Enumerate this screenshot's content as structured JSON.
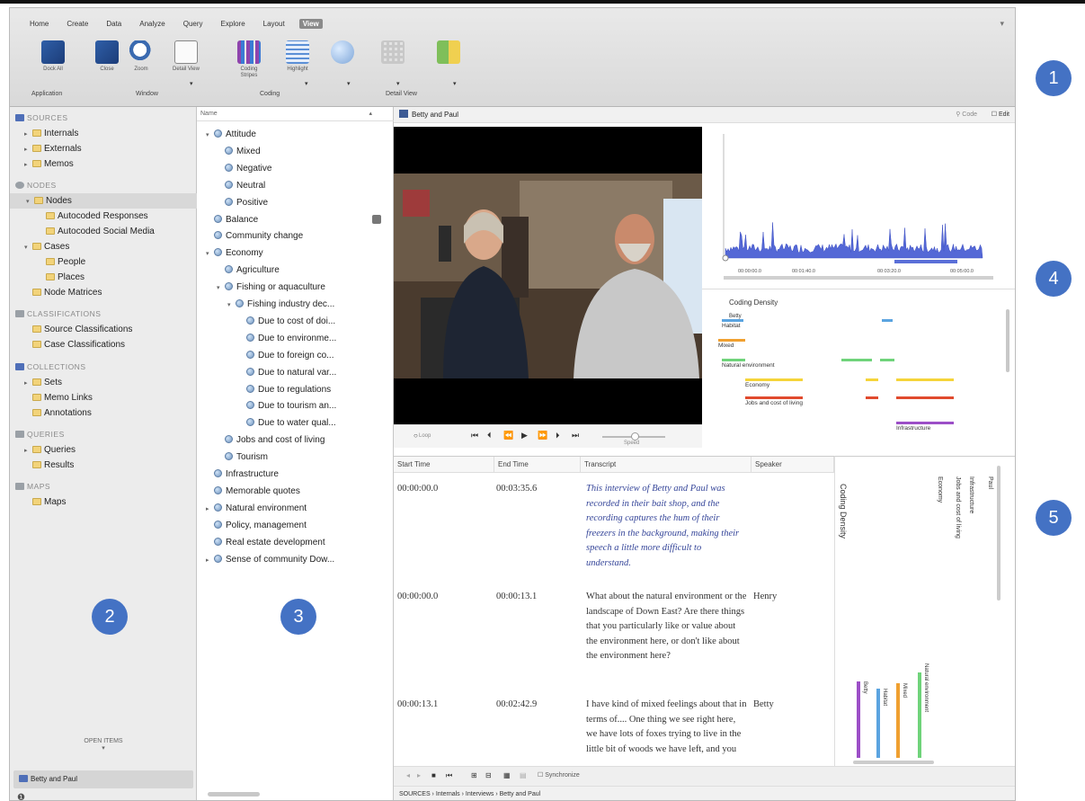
{
  "ribbon": {
    "menu": [
      "Home",
      "Create",
      "Data",
      "Analyze",
      "Query",
      "Explore",
      "Layout",
      "View"
    ],
    "active_menu": "View",
    "buttons": [
      {
        "name": "dock-all-button",
        "label": "Dock All"
      },
      {
        "name": "close-button",
        "label": "Close"
      },
      {
        "name": "zoom-button",
        "label": "Zoom"
      },
      {
        "name": "detail-view-button",
        "label": "Detail View"
      },
      {
        "name": "coding-stripes-button",
        "label": "Coding Stripes"
      },
      {
        "name": "highlight-button",
        "label": "Highlight"
      }
    ],
    "groups": [
      "Application",
      "Window",
      "Coding",
      "Detail View"
    ]
  },
  "nav": {
    "sources_header": "SOURCES",
    "internals": "Internals",
    "externals": "Externals",
    "memos": "Memos",
    "nodes_header": "NODES",
    "nodes": "Nodes",
    "autocoded_responses": "Autocoded Responses",
    "autocoded_social": "Autocoded Social Media",
    "cases": "Cases",
    "people": "People",
    "places": "Places",
    "node_matrices": "Node Matrices",
    "classifications_header": "CLASSIFICATIONS",
    "source_class": "Source Classifications",
    "case_class": "Case Classifications",
    "collections_header": "COLLECTIONS",
    "sets": "Sets",
    "memo_links": "Memo Links",
    "annotations": "Annotations",
    "queries_header": "QUERIES",
    "queries": "Queries",
    "results": "Results",
    "maps_header": "MAPS",
    "maps": "Maps",
    "open_items": "OPEN ITEMS",
    "open_item": "Betty and Paul"
  },
  "list": {
    "header": "Name",
    "nodes": [
      {
        "label": "Attitude",
        "indent": 0,
        "toggle": "▾"
      },
      {
        "label": "Mixed",
        "indent": 1,
        "toggle": ""
      },
      {
        "label": "Negative",
        "indent": 1,
        "toggle": ""
      },
      {
        "label": "Neutral",
        "indent": 1,
        "toggle": ""
      },
      {
        "label": "Positive",
        "indent": 1,
        "toggle": ""
      },
      {
        "label": "Balance",
        "indent": 0,
        "toggle": ""
      },
      {
        "label": "Community change",
        "indent": 0,
        "toggle": ""
      },
      {
        "label": "Economy",
        "indent": 0,
        "toggle": "▾"
      },
      {
        "label": "Agriculture",
        "indent": 1,
        "toggle": ""
      },
      {
        "label": "Fishing or aquaculture",
        "indent": 1,
        "toggle": "▾"
      },
      {
        "label": "Fishing industry dec...",
        "indent": 2,
        "toggle": "▾"
      },
      {
        "label": "Due to cost of doi...",
        "indent": 3,
        "toggle": ""
      },
      {
        "label": "Due to environme...",
        "indent": 3,
        "toggle": ""
      },
      {
        "label": "Due to foreign co...",
        "indent": 3,
        "toggle": ""
      },
      {
        "label": "Due to natural var...",
        "indent": 3,
        "toggle": ""
      },
      {
        "label": "Due to regulations",
        "indent": 3,
        "toggle": ""
      },
      {
        "label": "Due to tourism an...",
        "indent": 3,
        "toggle": ""
      },
      {
        "label": "Due to water qual...",
        "indent": 3,
        "toggle": ""
      },
      {
        "label": "Jobs and cost of living",
        "indent": 1,
        "toggle": ""
      },
      {
        "label": "Tourism",
        "indent": 1,
        "toggle": ""
      },
      {
        "label": "Infrastructure",
        "indent": 0,
        "toggle": ""
      },
      {
        "label": "Memorable quotes",
        "indent": 0,
        "toggle": ""
      },
      {
        "label": "Natural environment",
        "indent": 0,
        "toggle": "▸"
      },
      {
        "label": "Policy, management",
        "indent": 0,
        "toggle": ""
      },
      {
        "label": "Real estate development",
        "indent": 0,
        "toggle": ""
      },
      {
        "label": "Sense of community Dow...",
        "indent": 0,
        "toggle": "▸"
      }
    ]
  },
  "detail": {
    "title": "Betty and Paul",
    "code_label": "Code",
    "edit_label": "Edit",
    "loop_label": "Loop",
    "speed_label": "Speed",
    "timeline_ticks": [
      "00:00:00.0",
      "00:01:40.0",
      "00:03:20.0",
      "00:05:00.0"
    ],
    "coding_density": "Coding Density",
    "stripe_person": "Betty",
    "stripes": [
      {
        "label": "Habitat",
        "color": "#5ba4e0"
      },
      {
        "label": "Mixed",
        "color": "#f0a030"
      },
      {
        "label": "Natural environment",
        "color": "#6fd37a"
      },
      {
        "label": "Economy",
        "color": "#f5d43a"
      },
      {
        "label": "Jobs and cost of living",
        "color": "#e04a2e"
      },
      {
        "label": "Infrastructure",
        "color": "#9c4fc7"
      }
    ],
    "transcript_headers": [
      "Start Time",
      "End Time",
      "Transcript",
      "Speaker"
    ],
    "transcript_rows": [
      {
        "start": "00:00:00.0",
        "end": "00:03:35.6",
        "text": "This interview of Betty and Paul was recorded in their bait shop, and the recording captures the hum of their freezers in the background, making their speech a little more difficult to understand.",
        "speaker": "",
        "italic": true
      },
      {
        "start": "00:00:00.0",
        "end": "00:00:13.1",
        "text": "What about the natural environment or the landscape of Down East? Are there things that you particularly like or value about the environment here, or don't like about the environment here?",
        "speaker": "Henry",
        "italic": false
      },
      {
        "start": "00:00:13.1",
        "end": "00:02:42.9",
        "text": "I have kind of mixed feelings about that in terms of.... One thing we see right here, we have lots of foxes trying to live in the little bit of woods we have left, and you",
        "speaker": "Betty",
        "italic": false
      }
    ],
    "right_vertical": [
      "Coding Density",
      "Economy",
      "Jobs and cost of living",
      "Infrastructure",
      "Paul"
    ],
    "right_bottom_vertical": [
      "Betty",
      "Habitat",
      "Mixed",
      "Natural environment"
    ],
    "synchronize": "Synchronize",
    "breadcrumb": "SOURCES  ›  Internals  ›  Interviews  ›  Betty and Paul"
  },
  "callouts": [
    "1",
    "2",
    "3",
    "4",
    "5"
  ]
}
